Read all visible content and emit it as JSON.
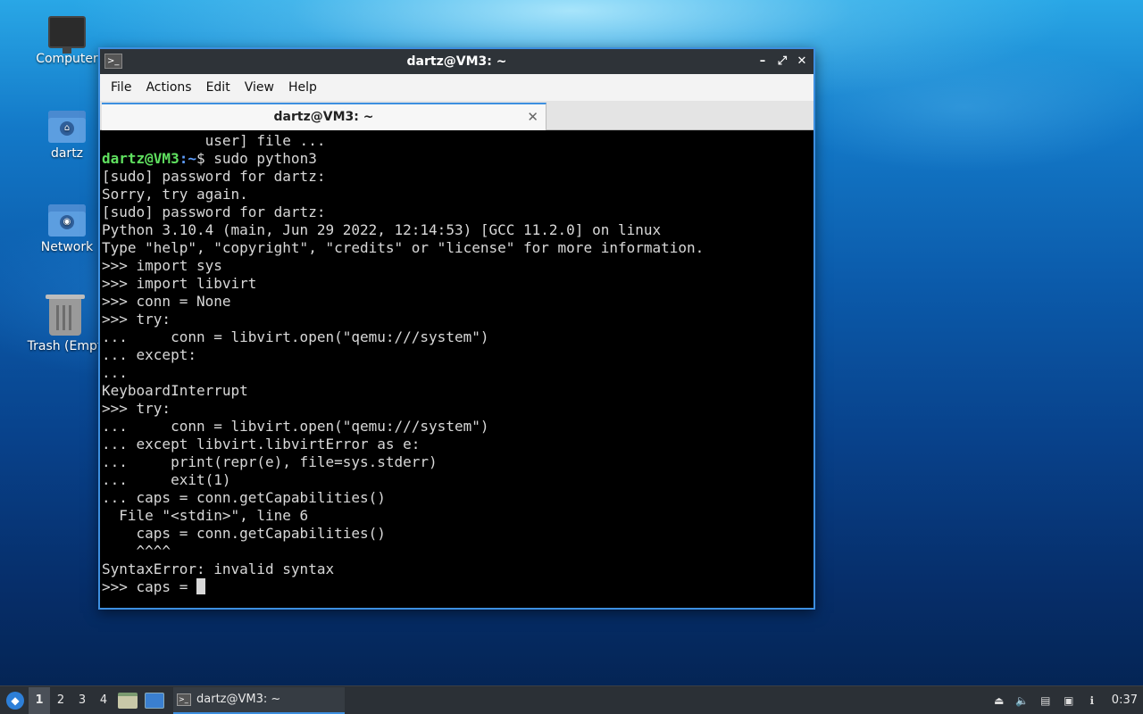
{
  "desktop": {
    "icons": [
      {
        "label": "Computer",
        "icon": "computer-icon"
      },
      {
        "label": "dartz",
        "icon": "home-folder-icon"
      },
      {
        "label": "Network",
        "icon": "network-folder-icon"
      },
      {
        "label": "Trash (Empt",
        "icon": "trash-icon"
      }
    ]
  },
  "window": {
    "title": "dartz@VM3: ~",
    "controls": {
      "minimize": "–",
      "maximize": "⤢",
      "close": "✕"
    },
    "menu": [
      "File",
      "Actions",
      "Edit",
      "View",
      "Help"
    ],
    "tab": {
      "label": "dartz@VM3: ~",
      "close": "✕"
    }
  },
  "terminal": {
    "lines": [
      "            user] file ...",
      "PROMPT",
      "[sudo] password for dartz:",
      "Sorry, try again.",
      "[sudo] password for dartz:",
      "Python 3.10.4 (main, Jun 29 2022, 12:14:53) [GCC 11.2.0] on linux",
      "Type \"help\", \"copyright\", \"credits\" or \"license\" for more information.",
      ">>> import sys",
      ">>> import libvirt",
      ">>> conn = None",
      ">>> try:",
      "...     conn = libvirt.open(\"qemu:///system\")",
      "... except:",
      "...",
      "KeyboardInterrupt",
      ">>> try:",
      "...     conn = libvirt.open(\"qemu:///system\")",
      "... except libvirt.libvirtError as e:",
      "...     print(repr(e), file=sys.stderr)",
      "...     exit(1)",
      "... caps = conn.getCapabilities()",
      "  File \"<stdin>\", line 6",
      "    caps = conn.getCapabilities()",
      "    ^^^^",
      "SyntaxError: invalid syntax",
      "CURRENT"
    ],
    "prompt": {
      "user": "dartz@VM3",
      "sep": ":",
      "path": "~",
      "symbol": "$",
      "command": " sudo python3"
    },
    "current_input": ">>> caps = "
  },
  "taskbar": {
    "workspaces": [
      "1",
      "2",
      "3",
      "4"
    ],
    "active_workspace": "1",
    "task": {
      "label": "dartz@VM3: ~"
    },
    "clock": "0:37"
  }
}
